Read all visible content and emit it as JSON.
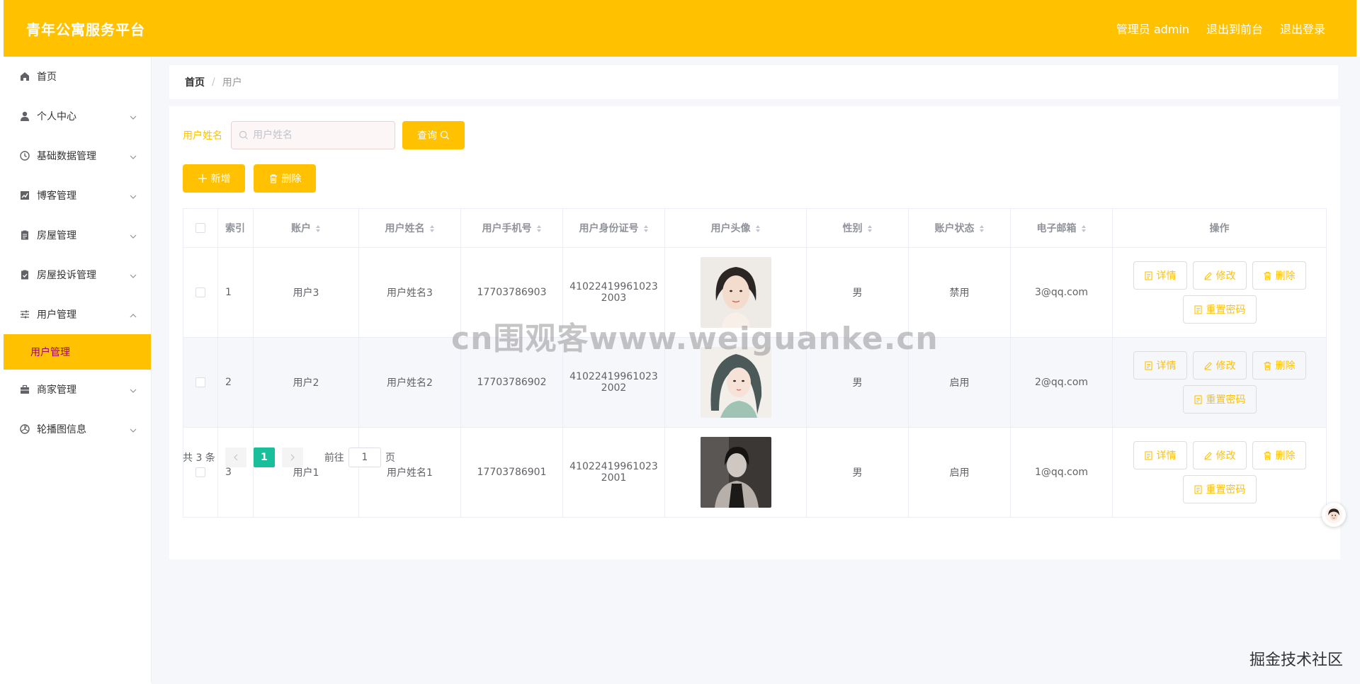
{
  "header": {
    "brand": "青年公寓服务平台",
    "admin": "管理员 admin",
    "to_front": "退出到前台",
    "logout": "退出登录"
  },
  "sidebar": {
    "items": [
      {
        "label": "首页",
        "icon": "home-icon",
        "has_arrow": false
      },
      {
        "label": "个人中心",
        "icon": "user-icon",
        "has_arrow": true
      },
      {
        "label": "基础数据管理",
        "icon": "clock-icon",
        "has_arrow": true
      },
      {
        "label": "博客管理",
        "icon": "chart-icon",
        "has_arrow": true
      },
      {
        "label": "房屋管理",
        "icon": "clipboard-icon",
        "has_arrow": true
      },
      {
        "label": "房屋投诉管理",
        "icon": "clipboard-check-icon",
        "has_arrow": true
      },
      {
        "label": "用户管理",
        "icon": "sliders-icon",
        "has_arrow": true,
        "expanded": true
      },
      {
        "label": "商家管理",
        "icon": "briefcase-icon",
        "has_arrow": true
      },
      {
        "label": "轮播图信息",
        "icon": "aperture-icon",
        "has_arrow": true
      }
    ],
    "active_sub": "用户管理"
  },
  "breadcrumb": {
    "home": "首页",
    "sep": "/",
    "current": "用户"
  },
  "search": {
    "label": "用户姓名",
    "placeholder": "用户姓名",
    "value": "",
    "button": "查询"
  },
  "actions": {
    "add": "新增",
    "delete": "删除"
  },
  "table": {
    "headers": {
      "index": "索引",
      "account": "账户",
      "name": "用户姓名",
      "phone": "用户手机号",
      "idcard": "用户身份证号",
      "avatar": "用户头像",
      "gender": "性别",
      "status": "账户状态",
      "email": "电子邮箱",
      "ops": "操作"
    },
    "rows": [
      {
        "index": "1",
        "account": "用户3",
        "name": "用户姓名3",
        "phone": "17703786903",
        "idcard_l1": "41022419961023",
        "idcard_l2": "2003",
        "gender": "男",
        "status": "禁用",
        "email": "3@qq.com"
      },
      {
        "index": "2",
        "account": "用户2",
        "name": "用户姓名2",
        "phone": "17703786902",
        "idcard_l1": "41022419961023",
        "idcard_l2": "2002",
        "gender": "男",
        "status": "启用",
        "email": "2@qq.com"
      },
      {
        "index": "3",
        "account": "用户1",
        "name": "用户姓名1",
        "phone": "17703786901",
        "idcard_l1": "41022419961023",
        "idcard_l2": "2001",
        "gender": "男",
        "status": "启用",
        "email": "1@qq.com"
      }
    ],
    "op_labels": {
      "detail": "详情",
      "edit": "修改",
      "delete": "删除",
      "reset": "重置密码"
    }
  },
  "pagination": {
    "total": "共 3 条",
    "current": "1",
    "goto_prefix": "前往",
    "goto_value": "1",
    "goto_suffix": "页"
  },
  "overlay": {
    "watermark": "cn围观客www.weiguanke.cn",
    "corner": "掘金技术社区"
  },
  "colors": {
    "accent": "#ffc100",
    "active_page": "#19be9b"
  }
}
